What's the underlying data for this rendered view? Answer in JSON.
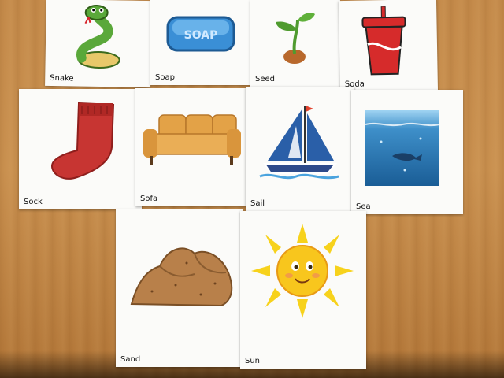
{
  "cards": [
    {
      "label": "Snake",
      "icon": "snake-icon"
    },
    {
      "label": "Soap",
      "icon": "soap-icon",
      "text": "SOAP"
    },
    {
      "label": "Seed",
      "icon": "seed-icon"
    },
    {
      "label": "Soda",
      "icon": "soda-icon"
    },
    {
      "label": "Sock",
      "icon": "sock-icon"
    },
    {
      "label": "Sofa",
      "icon": "sofa-icon"
    },
    {
      "label": "Sail",
      "icon": "sailboat-icon"
    },
    {
      "label": "Sea",
      "icon": "sea-icon"
    },
    {
      "label": "Sand",
      "icon": "sand-icon"
    },
    {
      "label": "Sun",
      "icon": "sun-icon"
    }
  ],
  "colors": {
    "table": "#c48a4a",
    "card": "#fbfbf9",
    "snake": "#5aa83a",
    "soap": "#3a8fd6",
    "seed": "#4f9b2f",
    "soda": "#d62b2b",
    "sock": "#c73532",
    "sofa": "#e3a247",
    "sail": "#2a5fa8",
    "sea": "#3e8fc9",
    "sand": "#b8804a",
    "sun": "#f7d21c"
  }
}
